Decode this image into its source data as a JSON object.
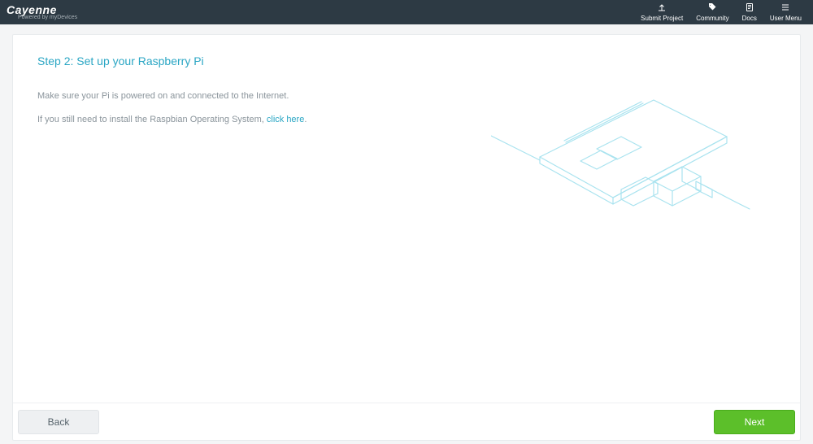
{
  "brand": {
    "name": "Cayenne",
    "tagline": "Powered by myDevices"
  },
  "nav": {
    "submit": "Submit Project",
    "community": "Community",
    "docs": "Docs",
    "usermenu": "User Menu"
  },
  "step": {
    "heading": "Step 2: Set up your Raspberry Pi",
    "line1": "Make sure your Pi is powered on and connected to the Internet.",
    "line2_prefix": "If you still need to install the Raspbian Operating System, ",
    "line2_link": "click here",
    "line2_suffix": "."
  },
  "buttons": {
    "back": "Back",
    "next": "Next"
  }
}
